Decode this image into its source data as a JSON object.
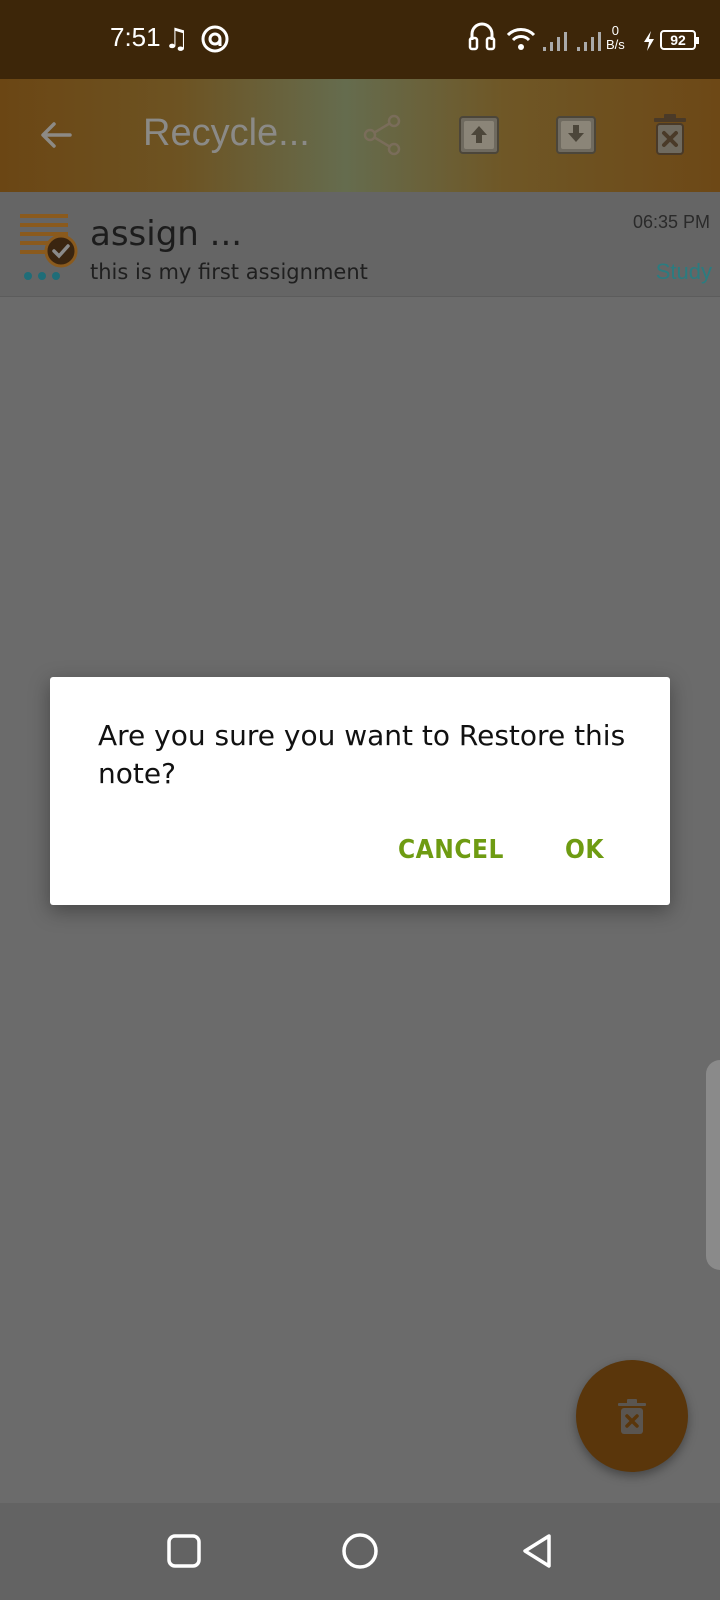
{
  "status_bar": {
    "time": "7:51",
    "net_speed_value": "0",
    "net_speed_unit": "B/s",
    "battery_level": "92"
  },
  "toolbar": {
    "title": "Recycle..."
  },
  "note": {
    "title": "assign ...",
    "body": "this is my first assignment",
    "time": "06:35 PM",
    "tag": "Study"
  },
  "dialog": {
    "message": "Are you sure you want to Restore this note?",
    "cancel_label": "CANCEL",
    "ok_label": "OK"
  },
  "colors": {
    "status_bar_bg": "#3d2609",
    "accent_green": "#6e9b12",
    "fab_bg": "#5a360b",
    "tag_teal": "#2b7c80"
  },
  "icons": {
    "status": [
      "music-note-icon",
      "at-sign-icon",
      "headphones-icon",
      "wifi-icon",
      "signal-icon",
      "charging-icon",
      "battery-icon"
    ],
    "toolbar": [
      "back-arrow-icon",
      "share-icon",
      "restore-icon",
      "archive-icon",
      "delete-icon"
    ],
    "fab": "delete-icon",
    "nav": [
      "recents-square-icon",
      "home-circle-icon",
      "back-triangle-icon"
    ]
  }
}
